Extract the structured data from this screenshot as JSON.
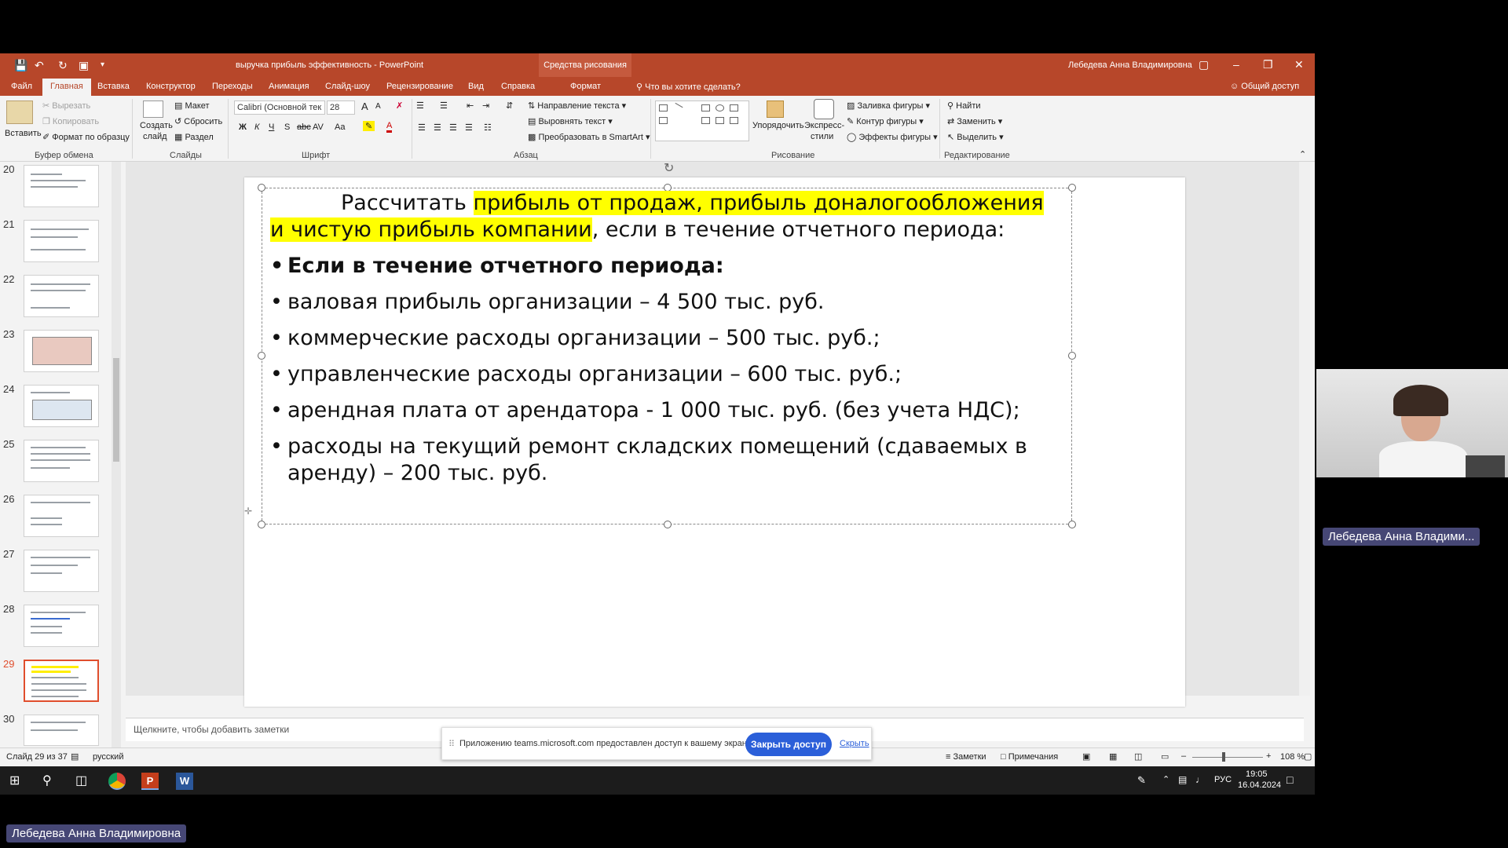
{
  "window": {
    "title": "выручка прибыль эффективность - PowerPoint",
    "context_tab": "Средства рисования",
    "user": "Лебедева Анна Владимировна"
  },
  "tabs": [
    "Файл",
    "Главная",
    "Вставка",
    "Конструктор",
    "Переходы",
    "Анимация",
    "Слайд-шоу",
    "Рецензирование",
    "Вид",
    "Справка",
    "Формат"
  ],
  "tell_me": "Что вы хотите сделать?",
  "share": "Общий доступ",
  "ribbon": {
    "clipboard": {
      "paste": "Вставить",
      "cut": "Вырезать",
      "copy": "Копировать",
      "format_painter": "Формат по образцу",
      "label": "Буфер обмена"
    },
    "slides": {
      "new_slide": "Создать",
      "new_slide_2": "слайд",
      "layout": "Макет",
      "reset": "Сбросить",
      "section": "Раздел",
      "label": "Слайды"
    },
    "font": {
      "name": "Calibri (Основной тек",
      "size": "28",
      "bold": "Ж",
      "italic": "К",
      "underline": "Ч",
      "shadow": "S",
      "strike": "abc",
      "spacing": "AV",
      "case": "Aa",
      "grow": "A",
      "shrink": "A",
      "label": "Шрифт"
    },
    "paragraph": {
      "text_direction": "Направление текста",
      "align_text": "Выровнять текст",
      "smartart": "Преобразовать в SmartArt",
      "label": "Абзац"
    },
    "drawing": {
      "arrange": "Упорядочить",
      "quick_styles": "Экспресс-",
      "quick_styles_2": "стили",
      "fill": "Заливка фигуры",
      "outline": "Контур фигуры",
      "effects": "Эффекты фигуры",
      "label": "Рисование"
    },
    "editing": {
      "find": "Найти",
      "replace": "Заменить",
      "select": "Выделить",
      "label": "Редактирование"
    }
  },
  "thumbnails": [
    "20",
    "21",
    "22",
    "23",
    "24",
    "25",
    "26",
    "27",
    "28",
    "29",
    "30"
  ],
  "slide": {
    "intro_plain": "Рассчитать ",
    "intro_hl_1": "прибыль от продаж,  прибыль до",
    "intro_hl_2": "налогообложения и чистую прибыль компании",
    "intro_rest": ", если в течение отчетного периода:",
    "bullets": [
      "Если в течение отчетного периода:",
      "валовая прибыль организации – 4 500 тыс. руб.",
      "коммерческие расходы организации – 500 тыс. руб.;",
      "управленческие расходы организации – 600 тыс. руб.;",
      "арендная плата от арендатора -  1 000 тыс. руб. (без учета НДС);",
      "расходы на текущий ремонт складских помещений (сдаваемых в аренду) – 200 тыс. руб."
    ]
  },
  "notes_placeholder": "Щелкните, чтобы добавить заметки",
  "status": {
    "slide_counter": "Слайд 29 из 37",
    "language": "русский",
    "notes": "Заметки",
    "comments": "Примечания",
    "zoom": "108 %"
  },
  "toast": {
    "message": "Приложению teams.microsoft.com предоставлен доступ к вашему экрану.",
    "stop_button": "Закрыть доступ",
    "hide_link": "Скрыть"
  },
  "taskbar": {
    "lang": "РУС",
    "time": "19:05",
    "date": "16.04.2024"
  },
  "participants": {
    "cam_name": "Лебедева Анна Владими...",
    "presenter_name": "Лебедева Анна Владимировна"
  },
  "colors": {
    "ppt_accent": "#b7472a",
    "highlight": "#ffff00",
    "teams_button": "#2b5fd9",
    "name_tag": "#464775"
  }
}
